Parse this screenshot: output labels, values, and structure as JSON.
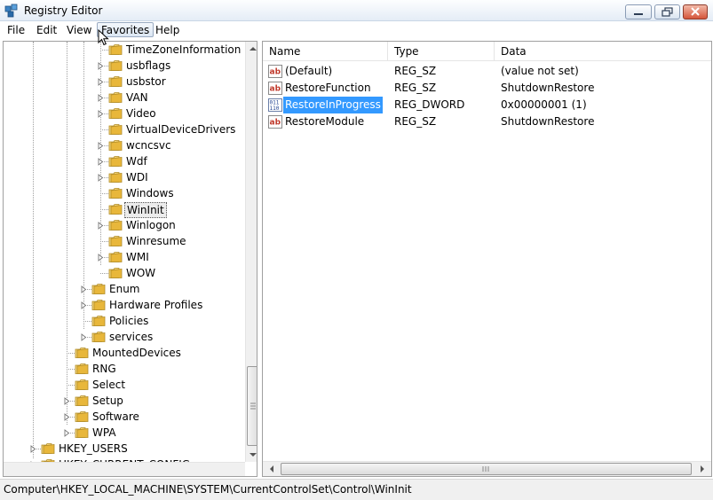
{
  "window": {
    "title": "Registry Editor"
  },
  "menu": [
    "File",
    "Edit",
    "View",
    "Favorites",
    "Help"
  ],
  "tree": [
    {
      "label": "TimeZoneInformation",
      "level": 4,
      "expandable": false,
      "selected": false
    },
    {
      "label": "usbflags",
      "level": 4,
      "expandable": true,
      "selected": false
    },
    {
      "label": "usbstor",
      "level": 4,
      "expandable": true,
      "selected": false
    },
    {
      "label": "VAN",
      "level": 4,
      "expandable": true,
      "selected": false
    },
    {
      "label": "Video",
      "level": 4,
      "expandable": true,
      "selected": false
    },
    {
      "label": "VirtualDeviceDrivers",
      "level": 4,
      "expandable": false,
      "selected": false
    },
    {
      "label": "wcncsvc",
      "level": 4,
      "expandable": true,
      "selected": false
    },
    {
      "label": "Wdf",
      "level": 4,
      "expandable": true,
      "selected": false
    },
    {
      "label": "WDI",
      "level": 4,
      "expandable": true,
      "selected": false
    },
    {
      "label": "Windows",
      "level": 4,
      "expandable": false,
      "selected": false
    },
    {
      "label": "WinInit",
      "level": 4,
      "expandable": false,
      "selected": true
    },
    {
      "label": "Winlogon",
      "level": 4,
      "expandable": true,
      "selected": false
    },
    {
      "label": "Winresume",
      "level": 4,
      "expandable": false,
      "selected": false
    },
    {
      "label": "WMI",
      "level": 4,
      "expandable": true,
      "selected": false
    },
    {
      "label": "WOW",
      "level": 4,
      "expandable": false,
      "selected": false
    },
    {
      "label": "Enum",
      "level": 3,
      "expandable": true,
      "selected": false
    },
    {
      "label": "Hardware Profiles",
      "level": 3,
      "expandable": true,
      "selected": false
    },
    {
      "label": "Policies",
      "level": 3,
      "expandable": false,
      "selected": false
    },
    {
      "label": "services",
      "level": 3,
      "expandable": true,
      "selected": false
    },
    {
      "label": "MountedDevices",
      "level": 2,
      "expandable": false,
      "selected": false
    },
    {
      "label": "RNG",
      "level": 2,
      "expandable": false,
      "selected": false
    },
    {
      "label": "Select",
      "level": 2,
      "expandable": false,
      "selected": false
    },
    {
      "label": "Setup",
      "level": 2,
      "expandable": true,
      "selected": false
    },
    {
      "label": "Software",
      "level": 2,
      "expandable": true,
      "selected": false
    },
    {
      "label": "WPA",
      "level": 2,
      "expandable": true,
      "selected": false
    },
    {
      "label": "HKEY_USERS",
      "level": 0,
      "expandable": true,
      "selected": false
    },
    {
      "label": "HKEY_CURRENT_CONFIG",
      "level": 0,
      "expandable": true,
      "selected": false
    }
  ],
  "list": {
    "columns": [
      "Name",
      "Type",
      "Data"
    ],
    "rows": [
      {
        "name": "(Default)",
        "type": "REG_SZ",
        "data": "(value not set)",
        "icon": "string-value-icon",
        "selected": false
      },
      {
        "name": "RestoreFunction",
        "type": "REG_SZ",
        "data": "ShutdownRestore",
        "icon": "string-value-icon",
        "selected": false
      },
      {
        "name": "RestoreInProgress",
        "type": "REG_DWORD",
        "data": "0x00000001 (1)",
        "icon": "binary-value-icon",
        "selected": true
      },
      {
        "name": "RestoreModule",
        "type": "REG_SZ",
        "data": "ShutdownRestore",
        "icon": "string-value-icon",
        "selected": false
      }
    ]
  },
  "status": {
    "path": "Computer\\HKEY_LOCAL_MACHINE\\SYSTEM\\CurrentControlSet\\Control\\WinInit"
  },
  "colors": {
    "selection": "#3399ff",
    "folder": "#e8b73b"
  }
}
